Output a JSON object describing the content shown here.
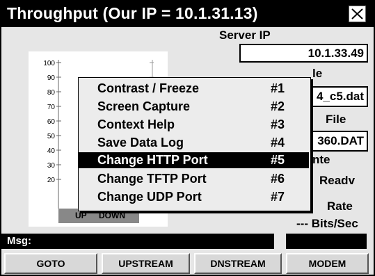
{
  "window": {
    "title": "Throughput (Our IP = 10.1.31.13)"
  },
  "fields": {
    "server_ip_label": "Server IP",
    "server_ip_value": "10.1.33.49",
    "file_label_partial": "le",
    "file_label_prefix_partial": "—",
    "file_value_partial": "4_c5.dat",
    "file2_label": "File",
    "file2_value_partial": "360.DAT",
    "state_label_partial": "nte",
    "state_value": "Readv",
    "rate_label": "Rate",
    "rate_value": "--- Bits/Sec"
  },
  "chart_data": {
    "type": "bar",
    "categories": [
      "UP",
      "DOWN"
    ],
    "values": [
      0,
      0
    ],
    "ylim": [
      0,
      100
    ],
    "yticks": [
      "100",
      "90",
      "80",
      "70",
      "60",
      "50",
      "40",
      "30",
      "20"
    ]
  },
  "context_menu": {
    "items": [
      {
        "label": "Contrast / Freeze",
        "shortcut": "#1"
      },
      {
        "label": "Screen Capture",
        "shortcut": "#2"
      },
      {
        "label": "Context Help",
        "shortcut": "#3"
      },
      {
        "label": "Save Data Log",
        "shortcut": "#4"
      },
      {
        "label": "Change HTTP Port",
        "shortcut": "#5"
      },
      {
        "label": "Change TFTP Port",
        "shortcut": "#6"
      },
      {
        "label": "Change UDP Port",
        "shortcut": "#7"
      }
    ],
    "selected_index": 4
  },
  "message": {
    "label": "Msg:"
  },
  "function_keys": [
    "GOTO",
    "UPSTREAM",
    "DNSTREAM",
    "MODEM"
  ]
}
